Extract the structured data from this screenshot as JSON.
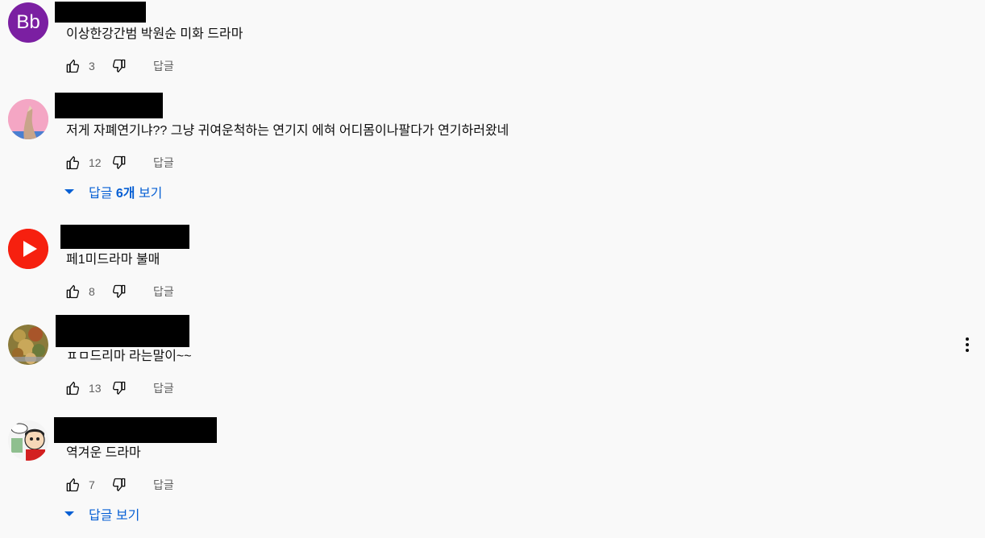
{
  "comments": [
    {
      "avatar_text": "Bb",
      "avatar_color": "#7b1fa2",
      "text": "이상한강간범 박원순 미화 드라마",
      "likes": "3",
      "reply_label": "답글"
    },
    {
      "text": "저게 자폐연기냐?? 그냥 귀여운척하는 연기지 에혀 어디몸이나팔다가 연기하러왔네",
      "likes": "12",
      "reply_label": "답글",
      "view_replies": {
        "prefix": "답글 ",
        "count": "6개",
        "suffix": " 보기"
      }
    },
    {
      "avatar_color": "#ff0000",
      "text": "페1미드라마 불매",
      "likes": "8",
      "reply_label": "답글"
    },
    {
      "text": "ㅍㅁ드리마 라는말이~~",
      "likes": "13",
      "reply_label": "답글"
    },
    {
      "text": "역겨운 드라마",
      "likes": "7",
      "reply_label": "답글",
      "view_replies": {
        "prefix": "답글 보기"
      }
    }
  ],
  "icons": {
    "like": "thumb-up-icon",
    "dislike": "thumb-down-icon",
    "more": "more-vert-icon",
    "expand": "arrow-drop-down-icon"
  },
  "colors": {
    "link_blue": "#065fd4",
    "meta_gray": "#606060",
    "background": "#f9f9f9"
  }
}
